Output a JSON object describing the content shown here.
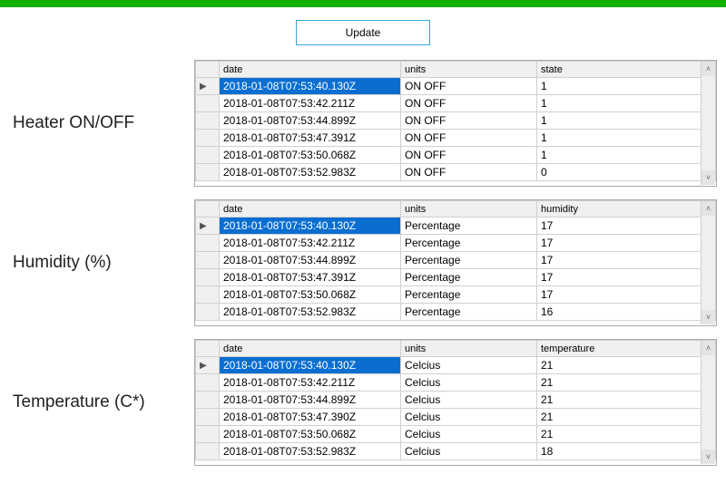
{
  "toolbar": {
    "update_label": "Update"
  },
  "sections": [
    {
      "label": "Heater ON/OFF",
      "columns": [
        "date",
        "units",
        "state"
      ],
      "rows": [
        {
          "date": "2018-01-08T07:53:40.130Z",
          "units": "ON OFF",
          "value": "1",
          "selected": true
        },
        {
          "date": "2018-01-08T07:53:42.211Z",
          "units": "ON OFF",
          "value": "1"
        },
        {
          "date": "2018-01-08T07:53:44.899Z",
          "units": "ON OFF",
          "value": "1"
        },
        {
          "date": "2018-01-08T07:53:47.391Z",
          "units": "ON OFF",
          "value": "1"
        },
        {
          "date": "2018-01-08T07:53:50.068Z",
          "units": "ON OFF",
          "value": "1"
        },
        {
          "date": "2018-01-08T07:53:52.983Z",
          "units": "ON OFF",
          "value": "0"
        }
      ]
    },
    {
      "label": "Humidity (%)",
      "columns": [
        "date",
        "units",
        "humidity"
      ],
      "rows": [
        {
          "date": "2018-01-08T07:53:40.130Z",
          "units": "Percentage",
          "value": "17",
          "selected": true
        },
        {
          "date": "2018-01-08T07:53:42.211Z",
          "units": "Percentage",
          "value": "17"
        },
        {
          "date": "2018-01-08T07:53:44.899Z",
          "units": "Percentage",
          "value": "17"
        },
        {
          "date": "2018-01-08T07:53:47.391Z",
          "units": "Percentage",
          "value": "17"
        },
        {
          "date": "2018-01-08T07:53:50.068Z",
          "units": "Percentage",
          "value": "17"
        },
        {
          "date": "2018-01-08T07:53:52.983Z",
          "units": "Percentage",
          "value": "16"
        }
      ]
    },
    {
      "label": "Temperature (C*)",
      "columns": [
        "date",
        "units",
        "temperature"
      ],
      "rows": [
        {
          "date": "2018-01-08T07:53:40.130Z",
          "units": "Celcius",
          "value": "21",
          "selected": true
        },
        {
          "date": "2018-01-08T07:53:42.211Z",
          "units": "Celcius",
          "value": "21"
        },
        {
          "date": "2018-01-08T07:53:44.899Z",
          "units": "Celcius",
          "value": "21"
        },
        {
          "date": "2018-01-08T07:53:47.390Z",
          "units": "Celcius",
          "value": "21"
        },
        {
          "date": "2018-01-08T07:53:50.068Z",
          "units": "Celcius",
          "value": "21"
        },
        {
          "date": "2018-01-08T07:53:52.983Z",
          "units": "Celcius",
          "value": "18"
        }
      ]
    }
  ]
}
